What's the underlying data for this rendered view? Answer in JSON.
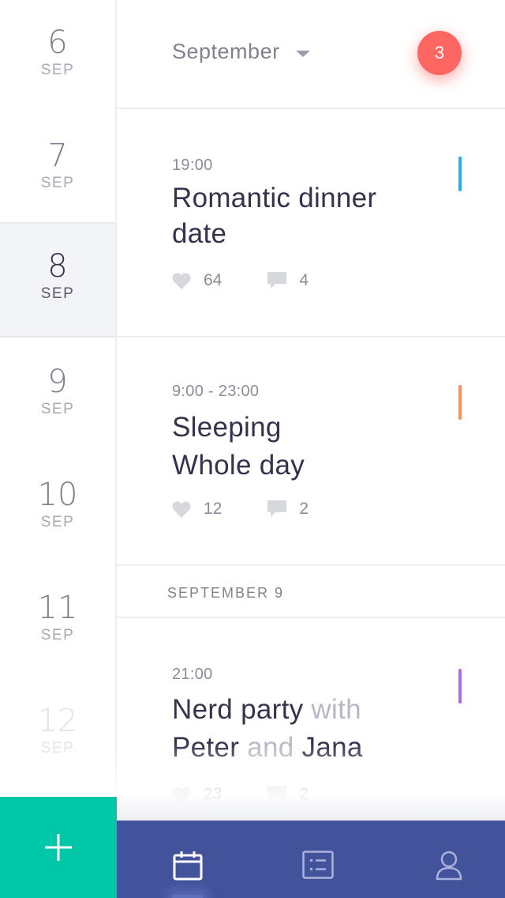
{
  "dates": [
    {
      "day": "6",
      "month": "SEP",
      "state": "normal"
    },
    {
      "day": "7",
      "month": "SEP",
      "state": "normal"
    },
    {
      "day": "8",
      "month": "SEP",
      "state": "selected"
    },
    {
      "day": "9",
      "month": "SEP",
      "state": "normal"
    },
    {
      "day": "10",
      "month": "SEP",
      "state": "normal"
    },
    {
      "day": "11",
      "month": "SEP",
      "state": "normal"
    },
    {
      "day": "12",
      "month": "SEP",
      "state": "faded"
    }
  ],
  "header": {
    "month_label": "September",
    "notification_count": "3"
  },
  "events": [
    {
      "time": "19:00",
      "title_line1": "Romantic dinner",
      "title_line2": "date",
      "likes": "64",
      "comments": "4",
      "accent_color": "#27b0e6"
    },
    {
      "time": "9:00 - 23:00",
      "title_line1": "Sleeping",
      "title_line2": "Whole day",
      "likes": "12",
      "comments": "2",
      "accent_color": "#f5915a"
    },
    {
      "time": "21:00",
      "title_line1_main": "Nerd party",
      "title_line1_muted": " with",
      "title_line2_a": "Peter",
      "title_line2_muted": " and ",
      "title_line2_b": "Jana",
      "likes": "23",
      "comments": "2",
      "accent_color": "#b46be0"
    }
  ],
  "section_header": "SEPTEMBER 9",
  "colors": {
    "add_button": "#00c7a8",
    "tab_bar": "#43539b",
    "badge": "#fe6661"
  },
  "tabs": [
    {
      "icon": "calendar-icon",
      "active": true
    },
    {
      "icon": "list-icon",
      "active": false
    },
    {
      "icon": "profile-icon",
      "active": false
    }
  ]
}
